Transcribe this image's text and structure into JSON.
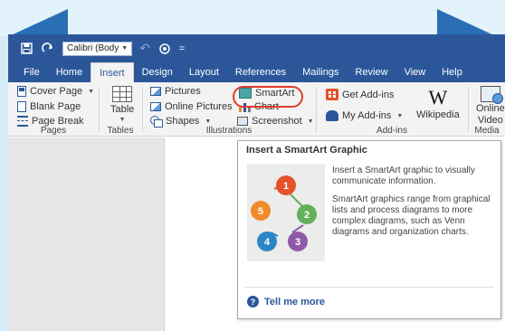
{
  "quick_access": {
    "save_icon": "save-icon",
    "redo_icon": "redo-icon",
    "font_name": "Calibri (Body",
    "undo_icon": "undo-icon",
    "touch_icon": "touch-mode-icon",
    "customize_icon": "customize-icon"
  },
  "menu": {
    "tabs": [
      "File",
      "Home",
      "Insert",
      "Design",
      "Layout",
      "References",
      "Mailings",
      "Review",
      "View",
      "Help"
    ],
    "active": "Insert"
  },
  "ribbon": {
    "pages": {
      "label": "Pages",
      "items": [
        "Cover Page",
        "Blank Page",
        "Page Break"
      ]
    },
    "tables": {
      "label": "Tables",
      "table_label": "Table"
    },
    "illustrations": {
      "label": "Illustrations",
      "pictures": "Pictures",
      "online_pictures": "Online Pictures",
      "shapes": "Shapes",
      "smartart": "SmartArt",
      "chart": "Chart",
      "screenshot": "Screenshot"
    },
    "addins": {
      "label": "Add-ins",
      "get_addins": "Get Add-ins",
      "my_addins": "My Add-ins",
      "wikipedia": "Wikipedia",
      "wikipedia_logo": "W"
    },
    "media": {
      "label": "Media",
      "online_video_line1": "Online",
      "online_video_line2": "Video"
    }
  },
  "tooltip": {
    "title": "Insert a SmartArt Graphic",
    "paragraph1": "Insert a SmartArt graphic to visually communicate information.",
    "paragraph2": "SmartArt graphics range from graphical lists and process diagrams to more complex diagrams, such as Venn diagrams and organization charts.",
    "link": "Tell me more",
    "diagram_numbers": [
      "1",
      "2",
      "3",
      "4",
      "5"
    ],
    "diagram_colors": [
      "#e5512b",
      "#62b05a",
      "#8e5aa8",
      "#2b86c6",
      "#f08a2a"
    ]
  },
  "colors": {
    "accent": "#2b579a",
    "highlight": "#e03a2b"
  }
}
